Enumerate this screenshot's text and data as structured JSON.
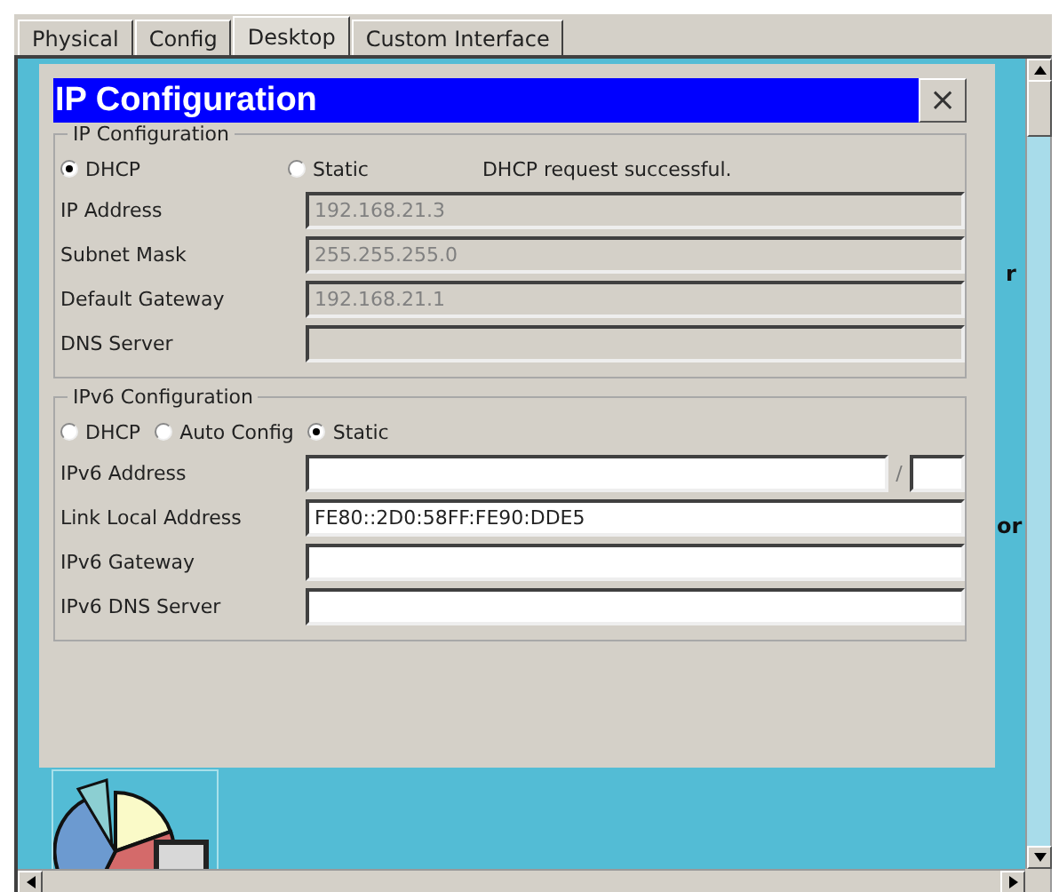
{
  "tabs": [
    {
      "label": "Physical",
      "selected": false
    },
    {
      "label": "Config",
      "selected": false
    },
    {
      "label": "Desktop",
      "selected": true
    },
    {
      "label": "Custom Interface",
      "selected": false
    }
  ],
  "desktop_labels": [
    {
      "text": "r"
    },
    {
      "text": "or"
    }
  ],
  "dialog": {
    "title": "IP Configuration",
    "close": "×",
    "ipv4": {
      "legend": "IP Configuration",
      "modes": [
        {
          "label": "DHCP",
          "selected": true
        },
        {
          "label": "Static",
          "selected": false
        }
      ],
      "status": "DHCP request successful.",
      "fields": [
        {
          "label": "IP Address",
          "value": "192.168.21.3",
          "disabled": true
        },
        {
          "label": "Subnet Mask",
          "value": "255.255.255.0",
          "disabled": true
        },
        {
          "label": "Default Gateway",
          "value": "192.168.21.1",
          "disabled": true
        },
        {
          "label": "DNS Server",
          "disabled": true
        }
      ]
    },
    "ipv6": {
      "legend": "IPv6 Configuration",
      "modes": [
        {
          "label": "DHCP",
          "selected": false
        },
        {
          "label": "Auto Config",
          "selected": false
        },
        {
          "label": "Static",
          "selected": true
        }
      ],
      "fields": [
        {
          "label": "IPv6 Address",
          "kind": "prefix",
          "separator": "/",
          "disabled": false
        },
        {
          "label": "Link Local Address",
          "value": "FE80::2D0:58FF:FE90:DDE5",
          "kind": "text",
          "disabled": false
        },
        {
          "label": "IPv6 Gateway",
          "kind": "text",
          "disabled": false
        },
        {
          "label": "IPv6 DNS Server",
          "kind": "text",
          "disabled": false
        }
      ]
    }
  }
}
